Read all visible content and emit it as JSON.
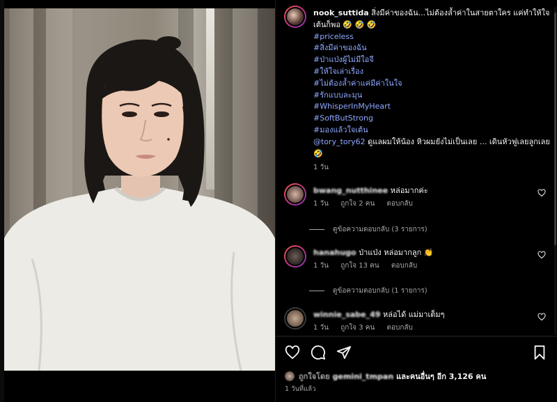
{
  "post": {
    "username": "nook_suttida",
    "caption": "สิ่งมีค่าของฉัน...ไม่ต้องล้ำค่าในสายตาใคร แค่ทำให้ใจเต้นก็พอ 🤣 🤣 🤣",
    "hashtags": [
      "#priceless",
      "#สิ่งมีค่าของฉัน",
      "#ป่าแป่งผู้ไม่มีใอจี",
      "#ให้ใจเล่าเรื่อง",
      "#ไม่ต้องล้ำค่าแค่มีค่าในใจ",
      "#รักแบบละมุน",
      "#WhisperInMyHeart",
      "#SoftButStrong",
      "#มองแล้วใจเต้น"
    ],
    "mention": "@tory_tory62",
    "mention_text": " ดูแลผมให้น้อง หิวผมยังไม่เป็นเลย ... เดินหัวฟูเลยลูกเลย 🤣",
    "age": "1 วัน"
  },
  "comments": [
    {
      "username": "bwang_nutthinee",
      "text": " หล่อมากค่ะ",
      "age": "1 วัน",
      "likes": "ถูกใจ 2 คน",
      "reply": "ตอบกลับ",
      "view_replies": "ดูข้อความตอบกลับ (3 รายการ)"
    },
    {
      "username": "hanahugo",
      "text": " ป่าแป่ง หล่อมากลูก 👏",
      "age": "1 วัน",
      "likes": "ถูกใจ 13 คน",
      "reply": "ตอบกลับ",
      "view_replies": "ดูข้อความตอบกลับ (1 รายการ)"
    },
    {
      "username": "winnie_sabe_49",
      "text": " หล่อได้ แม่มาเต็มๆ",
      "age": "1 วัน",
      "likes": "ถูกใจ 3 คน",
      "reply": "ตอบกลับ"
    }
  ],
  "likes_bar": {
    "liked_by_prefix": "ถูกใจโดย",
    "liked_by_user": "gemini_tmpan",
    "others": "และคนอื่นๆ อีก 3,126 คน",
    "time": "1 วันที่แล้ว"
  },
  "icons": {
    "like": "heart-icon",
    "comment": "comment-icon",
    "share": "send-icon",
    "save": "bookmark-icon"
  }
}
